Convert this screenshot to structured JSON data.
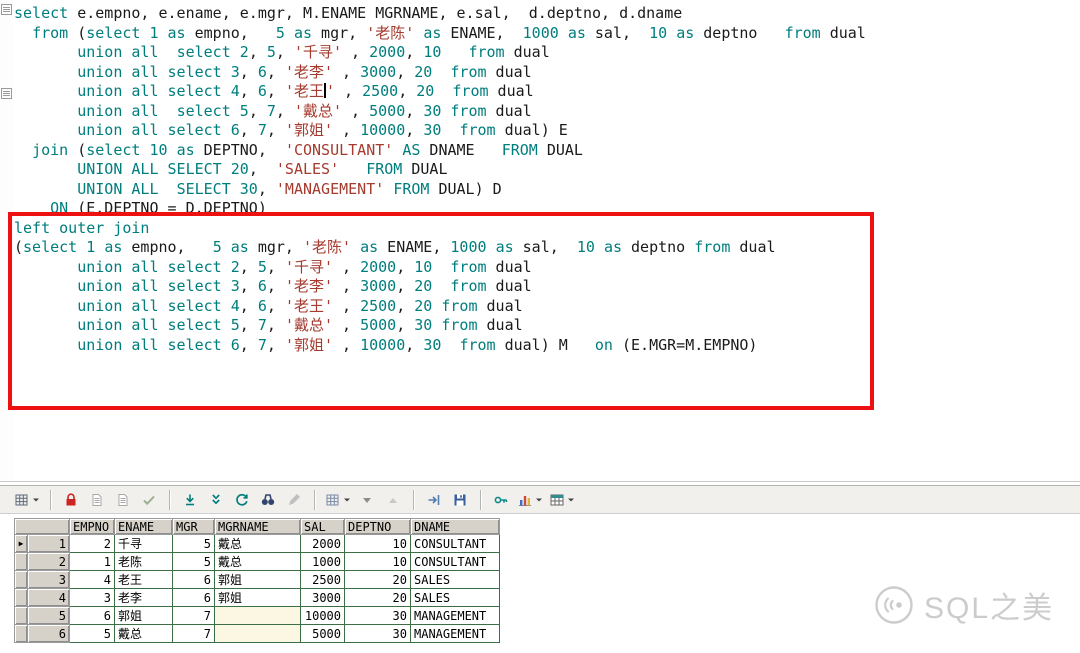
{
  "colors": {
    "kw": "#007d7d",
    "num": "#007d7d",
    "str": "#a53a2e",
    "plain": "#1a1a1a",
    "annot": "#ee1111",
    "gridline": "#3c6e46",
    "hdrbg": "#d6d2ca",
    "toolbarbg": "#f2f0ed",
    "nullbg": "#fbf7e3",
    "watermark": "#cccccc"
  },
  "editor": {
    "lines": [
      [
        [
          "k",
          "select"
        ],
        [
          "p",
          " e.empno, e.ename, e.mgr, M.ENAME MGRNAME, e.sal,  d.deptno, d.dname"
        ]
      ],
      [
        [
          "p",
          "  "
        ],
        [
          "k",
          "from"
        ],
        [
          "p",
          " ("
        ],
        [
          "k",
          "select"
        ],
        [
          "p",
          " "
        ],
        [
          "n",
          "1"
        ],
        [
          "p",
          " "
        ],
        [
          "k",
          "as"
        ],
        [
          "p",
          " empno,   "
        ],
        [
          "n",
          "5"
        ],
        [
          "p",
          " "
        ],
        [
          "k",
          "as"
        ],
        [
          "p",
          " mgr, "
        ],
        [
          "s",
          "'老陈'"
        ],
        [
          "p",
          " "
        ],
        [
          "k",
          "as"
        ],
        [
          "p",
          " ENAME,  "
        ],
        [
          "n",
          "1000"
        ],
        [
          "p",
          " "
        ],
        [
          "k",
          "as"
        ],
        [
          "p",
          " sal,  "
        ],
        [
          "n",
          "10"
        ],
        [
          "p",
          " "
        ],
        [
          "k",
          "as"
        ],
        [
          "p",
          " deptno   "
        ],
        [
          "k",
          "from"
        ],
        [
          "p",
          " dual"
        ]
      ],
      [
        [
          "p",
          "       "
        ],
        [
          "k",
          "union all"
        ],
        [
          "p",
          "  "
        ],
        [
          "k",
          "select"
        ],
        [
          "p",
          " "
        ],
        [
          "n",
          "2"
        ],
        [
          "p",
          ", "
        ],
        [
          "n",
          "5"
        ],
        [
          "p",
          ", "
        ],
        [
          "s",
          "'千寻'"
        ],
        [
          "p",
          " , "
        ],
        [
          "n",
          "2000"
        ],
        [
          "p",
          ", "
        ],
        [
          "n",
          "10"
        ],
        [
          "p",
          "   "
        ],
        [
          "k",
          "from"
        ],
        [
          "p",
          " dual"
        ]
      ],
      [
        [
          "p",
          "       "
        ],
        [
          "k",
          "union all"
        ],
        [
          "p",
          " "
        ],
        [
          "k",
          "select"
        ],
        [
          "p",
          " "
        ],
        [
          "n",
          "3"
        ],
        [
          "p",
          ", "
        ],
        [
          "n",
          "6"
        ],
        [
          "p",
          ", "
        ],
        [
          "s",
          "'老李'"
        ],
        [
          "p",
          " , "
        ],
        [
          "n",
          "3000"
        ],
        [
          "p",
          ", "
        ],
        [
          "n",
          "20"
        ],
        [
          "p",
          "  "
        ],
        [
          "k",
          "from"
        ],
        [
          "p",
          " dual"
        ]
      ],
      [
        [
          "p",
          "       "
        ],
        [
          "k",
          "union all"
        ],
        [
          "p",
          " "
        ],
        [
          "k",
          "select"
        ],
        [
          "p",
          " "
        ],
        [
          "n",
          "4"
        ],
        [
          "p",
          ", "
        ],
        [
          "n",
          "6"
        ],
        [
          "p",
          ", "
        ],
        [
          "s",
          "'老王"
        ],
        [
          "c",
          ""
        ],
        [
          "s",
          "'"
        ],
        [
          "p",
          " , "
        ],
        [
          "n",
          "2500"
        ],
        [
          "p",
          ", "
        ],
        [
          "n",
          "20"
        ],
        [
          "p",
          "  "
        ],
        [
          "k",
          "from"
        ],
        [
          "p",
          " dual"
        ]
      ],
      [
        [
          "p",
          "       "
        ],
        [
          "k",
          "union all"
        ],
        [
          "p",
          "  "
        ],
        [
          "k",
          "select"
        ],
        [
          "p",
          " "
        ],
        [
          "n",
          "5"
        ],
        [
          "p",
          ", "
        ],
        [
          "n",
          "7"
        ],
        [
          "p",
          ", "
        ],
        [
          "s",
          "'戴总'"
        ],
        [
          "p",
          " , "
        ],
        [
          "n",
          "5000"
        ],
        [
          "p",
          ", "
        ],
        [
          "n",
          "30"
        ],
        [
          "p",
          " "
        ],
        [
          "k",
          "from"
        ],
        [
          "p",
          " dual"
        ]
      ],
      [
        [
          "p",
          "       "
        ],
        [
          "k",
          "union all"
        ],
        [
          "p",
          " "
        ],
        [
          "k",
          "select"
        ],
        [
          "p",
          " "
        ],
        [
          "n",
          "6"
        ],
        [
          "p",
          ", "
        ],
        [
          "n",
          "7"
        ],
        [
          "p",
          ", "
        ],
        [
          "s",
          "'郭姐'"
        ],
        [
          "p",
          " , "
        ],
        [
          "n",
          "10000"
        ],
        [
          "p",
          ", "
        ],
        [
          "n",
          "30"
        ],
        [
          "p",
          "  "
        ],
        [
          "k",
          "from"
        ],
        [
          "p",
          " dual) E"
        ]
      ],
      [
        [
          "p",
          "  "
        ],
        [
          "k",
          "join"
        ],
        [
          "p",
          " ("
        ],
        [
          "k",
          "select"
        ],
        [
          "p",
          " "
        ],
        [
          "n",
          "10"
        ],
        [
          "p",
          " "
        ],
        [
          "k",
          "as"
        ],
        [
          "p",
          " DEPTNO,  "
        ],
        [
          "s",
          "'CONSULTANT'"
        ],
        [
          "p",
          " "
        ],
        [
          "k",
          "AS"
        ],
        [
          "p",
          " DNAME   "
        ],
        [
          "k",
          "FROM"
        ],
        [
          "p",
          " DUAL"
        ]
      ],
      [
        [
          "p",
          "       "
        ],
        [
          "k",
          "UNION ALL"
        ],
        [
          "p",
          " "
        ],
        [
          "k",
          "SELECT"
        ],
        [
          "p",
          " "
        ],
        [
          "n",
          "20"
        ],
        [
          "p",
          ",  "
        ],
        [
          "s",
          "'SALES'"
        ],
        [
          "p",
          "   "
        ],
        [
          "k",
          "FROM"
        ],
        [
          "p",
          " DUAL"
        ]
      ],
      [
        [
          "p",
          "       "
        ],
        [
          "k",
          "UNION ALL"
        ],
        [
          "p",
          "  "
        ],
        [
          "k",
          "SELECT"
        ],
        [
          "p",
          " "
        ],
        [
          "n",
          "30"
        ],
        [
          "p",
          ", "
        ],
        [
          "s",
          "'MANAGEMENT'"
        ],
        [
          "p",
          " "
        ],
        [
          "k",
          "FROM"
        ],
        [
          "p",
          " DUAL) D"
        ]
      ],
      [
        [
          "p",
          "    "
        ],
        [
          "k",
          "ON"
        ],
        [
          "p",
          " (E.DEPTNO = D.DEPTNO)"
        ]
      ],
      [
        [
          "k",
          "left outer join"
        ]
      ],
      [
        [
          "p",
          "("
        ],
        [
          "k",
          "select"
        ],
        [
          "p",
          " "
        ],
        [
          "n",
          "1"
        ],
        [
          "p",
          " "
        ],
        [
          "k",
          "as"
        ],
        [
          "p",
          " empno,   "
        ],
        [
          "n",
          "5"
        ],
        [
          "p",
          " "
        ],
        [
          "k",
          "as"
        ],
        [
          "p",
          " mgr, "
        ],
        [
          "s",
          "'老陈'"
        ],
        [
          "p",
          " "
        ],
        [
          "k",
          "as"
        ],
        [
          "p",
          " ENAME, "
        ],
        [
          "n",
          "1000"
        ],
        [
          "p",
          " "
        ],
        [
          "k",
          "as"
        ],
        [
          "p",
          " sal,  "
        ],
        [
          "n",
          "10"
        ],
        [
          "p",
          " "
        ],
        [
          "k",
          "as"
        ],
        [
          "p",
          " deptno "
        ],
        [
          "k",
          "from"
        ],
        [
          "p",
          " dual"
        ]
      ],
      [
        [
          "p",
          "       "
        ],
        [
          "k",
          "union all"
        ],
        [
          "p",
          " "
        ],
        [
          "k",
          "select"
        ],
        [
          "p",
          " "
        ],
        [
          "n",
          "2"
        ],
        [
          "p",
          ", "
        ],
        [
          "n",
          "5"
        ],
        [
          "p",
          ", "
        ],
        [
          "s",
          "'千寻'"
        ],
        [
          "p",
          " , "
        ],
        [
          "n",
          "2000"
        ],
        [
          "p",
          ", "
        ],
        [
          "n",
          "10"
        ],
        [
          "p",
          "  "
        ],
        [
          "k",
          "from"
        ],
        [
          "p",
          " dual"
        ]
      ],
      [
        [
          "p",
          "       "
        ],
        [
          "k",
          "union all"
        ],
        [
          "p",
          " "
        ],
        [
          "k",
          "select"
        ],
        [
          "p",
          " "
        ],
        [
          "n",
          "3"
        ],
        [
          "p",
          ", "
        ],
        [
          "n",
          "6"
        ],
        [
          "p",
          ", "
        ],
        [
          "s",
          "'老李'"
        ],
        [
          "p",
          " , "
        ],
        [
          "n",
          "3000"
        ],
        [
          "p",
          ", "
        ],
        [
          "n",
          "20"
        ],
        [
          "p",
          "  "
        ],
        [
          "k",
          "from"
        ],
        [
          "p",
          " dual"
        ]
      ],
      [
        [
          "p",
          "       "
        ],
        [
          "k",
          "union all"
        ],
        [
          "p",
          " "
        ],
        [
          "k",
          "select"
        ],
        [
          "p",
          " "
        ],
        [
          "n",
          "4"
        ],
        [
          "p",
          ", "
        ],
        [
          "n",
          "6"
        ],
        [
          "p",
          ", "
        ],
        [
          "s",
          "'老王'"
        ],
        [
          "p",
          " , "
        ],
        [
          "n",
          "2500"
        ],
        [
          "p",
          ", "
        ],
        [
          "n",
          "20"
        ],
        [
          "p",
          " "
        ],
        [
          "k",
          "from"
        ],
        [
          "p",
          " dual"
        ]
      ],
      [
        [
          "p",
          "       "
        ],
        [
          "k",
          "union all"
        ],
        [
          "p",
          " "
        ],
        [
          "k",
          "select"
        ],
        [
          "p",
          " "
        ],
        [
          "n",
          "5"
        ],
        [
          "p",
          ", "
        ],
        [
          "n",
          "7"
        ],
        [
          "p",
          ", "
        ],
        [
          "s",
          "'戴总'"
        ],
        [
          "p",
          " , "
        ],
        [
          "n",
          "5000"
        ],
        [
          "p",
          ", "
        ],
        [
          "n",
          "30"
        ],
        [
          "p",
          " "
        ],
        [
          "k",
          "from"
        ],
        [
          "p",
          " dual"
        ]
      ],
      [
        [
          "p",
          "       "
        ],
        [
          "k",
          "union all"
        ],
        [
          "p",
          " "
        ],
        [
          "k",
          "select"
        ],
        [
          "p",
          " "
        ],
        [
          "n",
          "6"
        ],
        [
          "p",
          ", "
        ],
        [
          "n",
          "7"
        ],
        [
          "p",
          ", "
        ],
        [
          "s",
          "'郭姐'"
        ],
        [
          "p",
          " , "
        ],
        [
          "n",
          "10000"
        ],
        [
          "p",
          ", "
        ],
        [
          "n",
          "30"
        ],
        [
          "p",
          "  "
        ],
        [
          "k",
          "from"
        ],
        [
          "p",
          " dual) M   "
        ],
        [
          "k",
          "on"
        ],
        [
          "p",
          " (E.MGR=M.EMPNO)"
        ]
      ]
    ]
  },
  "toolbar": {
    "items": [
      {
        "name": "grid-edit-options",
        "icon": "gridpencil",
        "color": "#5b6b7b",
        "dropdown": true
      },
      {
        "sep": true
      },
      {
        "name": "lock",
        "icon": "lock",
        "color": "#cc2420"
      },
      {
        "name": "copy-record",
        "icon": "doc",
        "color": "#a8a8a8"
      },
      {
        "name": "paste-record",
        "icon": "doc",
        "color": "#a8a8a8"
      },
      {
        "name": "post-changes",
        "icon": "check",
        "color": "#9ab08e"
      },
      {
        "sep": true
      },
      {
        "name": "fetch-next-page",
        "icon": "downbar",
        "color": "#007d7d"
      },
      {
        "name": "fetch-all",
        "icon": "downall",
        "color": "#007d7d"
      },
      {
        "name": "refresh",
        "icon": "refresh",
        "color": "#007d7d"
      },
      {
        "name": "find",
        "icon": "binoc",
        "color": "#31456e"
      },
      {
        "name": "edit-data",
        "icon": "pencil",
        "color": "#c0c0c0"
      },
      {
        "sep": true
      },
      {
        "name": "result-grid-options",
        "icon": "grid",
        "color": "#7b8aa5",
        "dropdown": true
      },
      {
        "name": "sort-descending",
        "icon": "tridown",
        "color": "#8d8d8d"
      },
      {
        "name": "sort-ascending",
        "icon": "triup",
        "color": "#c8c8c8"
      },
      {
        "sep": true
      },
      {
        "name": "export-results",
        "icon": "exportarrow",
        "color": "#4f7db0"
      },
      {
        "name": "save-results",
        "icon": "disk",
        "color": "#3a5d9e"
      },
      {
        "sep": true
      },
      {
        "name": "linked-query",
        "icon": "key",
        "color": "#0e8a8a"
      },
      {
        "name": "chart-view",
        "icon": "chart",
        "color": "#3b6cc7",
        "dropdown": true
      },
      {
        "name": "report-view",
        "icon": "table",
        "color": "#2f8d8d",
        "dropdown": true
      }
    ]
  },
  "grid": {
    "marker": "▶",
    "columns": [
      {
        "label": "EMPNO",
        "align": "right"
      },
      {
        "label": "ENAME",
        "align": "left"
      },
      {
        "label": "MGR",
        "align": "right"
      },
      {
        "label": "MGRNAME",
        "align": "left"
      },
      {
        "label": "SAL",
        "align": "right"
      },
      {
        "label": "DEPTNO",
        "align": "right"
      },
      {
        "label": "DNAME",
        "align": "left"
      }
    ],
    "rows": [
      {
        "num": "1",
        "active": true,
        "cells": [
          "2",
          "千寻",
          "5",
          "戴总",
          "2000",
          "10",
          "CONSULTANT"
        ]
      },
      {
        "num": "2",
        "cells": [
          "1",
          "老陈",
          "5",
          "戴总",
          "1000",
          "10",
          "CONSULTANT"
        ]
      },
      {
        "num": "3",
        "cells": [
          "4",
          "老王",
          "6",
          "郭姐",
          "2500",
          "20",
          "SALES"
        ]
      },
      {
        "num": "4",
        "cells": [
          "3",
          "老李",
          "6",
          "郭姐",
          "3000",
          "20",
          "SALES"
        ]
      },
      {
        "num": "5",
        "cells": [
          "6",
          "郭姐",
          "7",
          "",
          "10000",
          "30",
          "MANAGEMENT"
        ]
      },
      {
        "num": "6",
        "cells": [
          "5",
          "戴总",
          "7",
          "",
          "5000",
          "30",
          "MANAGEMENT"
        ]
      }
    ]
  },
  "watermark": {
    "text": "SQL之美"
  }
}
